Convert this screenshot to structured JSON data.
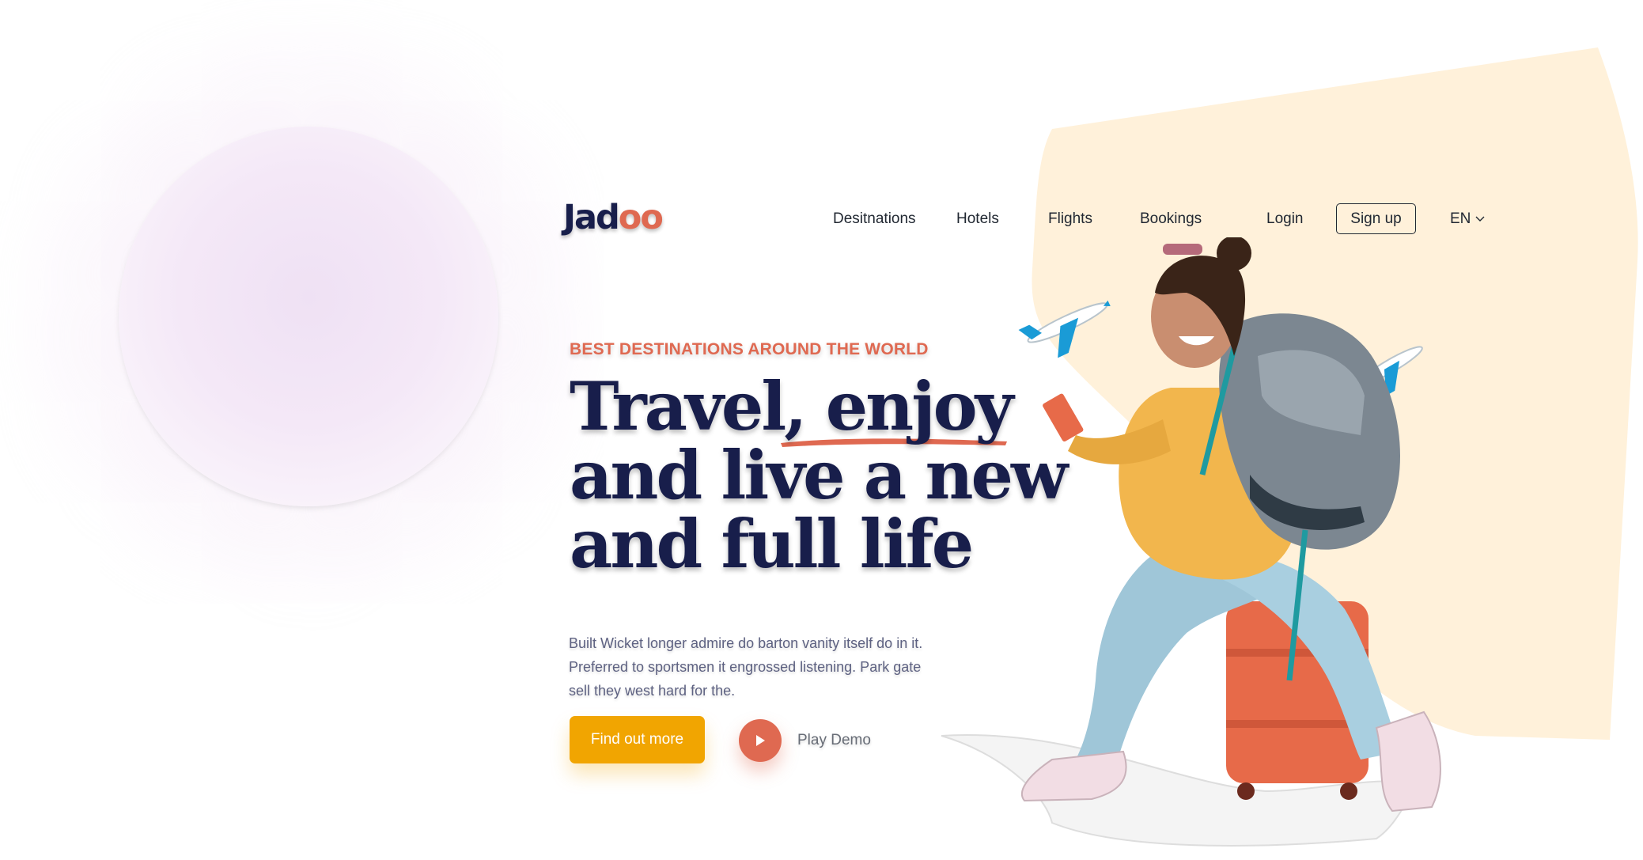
{
  "brand": {
    "logo_text_main": "Jad",
    "logo_text_accent": "oo"
  },
  "nav": {
    "items": [
      {
        "label": "Desitnations"
      },
      {
        "label": "Hotels"
      },
      {
        "label": "Flights"
      },
      {
        "label": "Bookings"
      }
    ],
    "login_label": "Login",
    "signup_label": "Sign up",
    "language": "EN"
  },
  "hero": {
    "tagline": "BEST DESTINATIONS AROUND THE WORLD",
    "headline_line1_a": "Travel, ",
    "headline_line1_b": "enjoy",
    "headline_line2": "and live a new",
    "headline_line3": "and full life",
    "body": "Built Wicket longer admire do barton vanity itself do in it. Preferred to sportsmen it engrossed listening. Park gate sell they west hard for the.",
    "cta_label": "Find out more",
    "play_label": "Play Demo"
  },
  "colors": {
    "navy": "#181e4b",
    "coral": "#df6951",
    "amber": "#f1a501",
    "cream": "#fff1da",
    "muted": "#5e6282"
  }
}
